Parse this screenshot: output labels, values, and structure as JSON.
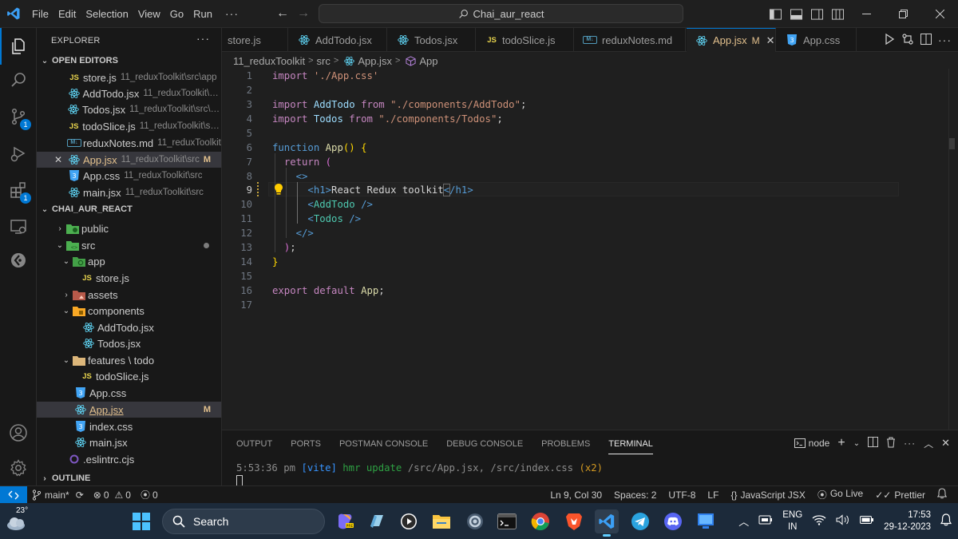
{
  "titlebar": {
    "menu": [
      "File",
      "Edit",
      "Selection",
      "View",
      "Go",
      "Run"
    ],
    "more": "···",
    "search_text": "Chai_aur_react",
    "window_controls": [
      "minimize",
      "restore",
      "close"
    ]
  },
  "activity_bar": {
    "items": [
      "explorer-icon",
      "search-icon",
      "source-control-icon",
      "run-debug-icon",
      "extensions-icon",
      "remote-explorer-icon",
      "git-lens-icon"
    ],
    "source_control_badge": "1",
    "extensions_badge": "1"
  },
  "sidebar": {
    "title": "EXPLORER",
    "more": "···",
    "open_editors_label": "OPEN EDITORS",
    "open_editors": [
      {
        "name": "store.js",
        "path": "11_reduxToolkit\\src\\app",
        "type": "js"
      },
      {
        "name": "AddTodo.jsx",
        "path": "11_reduxToolkit\\sr...",
        "type": "react"
      },
      {
        "name": "Todos.jsx",
        "path": "11_reduxToolkit\\src\\co...",
        "type": "react"
      },
      {
        "name": "todoSlice.js",
        "path": "11_reduxToolkit\\src...",
        "type": "js"
      },
      {
        "name": "reduxNotes.md",
        "path": "11_reduxToolkit",
        "type": "md"
      },
      {
        "name": "App.jsx",
        "path": "11_reduxToolkit\\src",
        "type": "react",
        "badge": "M"
      },
      {
        "name": "App.css",
        "path": "11_reduxToolkit\\src",
        "type": "css"
      },
      {
        "name": "main.jsx",
        "path": "11_reduxToolkit\\src",
        "type": "react"
      }
    ],
    "project_label": "CHAI_AUR_REACT",
    "tree": [
      {
        "name": "public",
        "kind": "folder",
        "depth": 1,
        "open": false
      },
      {
        "name": "src",
        "kind": "folder",
        "depth": 1,
        "open": true
      },
      {
        "name": "app",
        "kind": "folder",
        "depth": 2,
        "open": true
      },
      {
        "name": "store.js",
        "kind": "js",
        "depth": 3
      },
      {
        "name": "assets",
        "kind": "folder",
        "depth": 2,
        "open": false
      },
      {
        "name": "components",
        "kind": "folder",
        "depth": 2,
        "open": true
      },
      {
        "name": "AddTodo.jsx",
        "kind": "react",
        "depth": 3
      },
      {
        "name": "Todos.jsx",
        "kind": "react",
        "depth": 3
      },
      {
        "name": "features \\ todo",
        "kind": "folder",
        "depth": 2,
        "open": true
      },
      {
        "name": "todoSlice.js",
        "kind": "js",
        "depth": 3
      },
      {
        "name": "App.css",
        "kind": "css",
        "depth": 2
      },
      {
        "name": "App.jsx",
        "kind": "react",
        "depth": 2,
        "badge": "M"
      },
      {
        "name": "index.css",
        "kind": "css",
        "depth": 2
      },
      {
        "name": "main.jsx",
        "kind": "react",
        "depth": 2
      },
      {
        "name": ".eslintrc.cjs",
        "kind": "eslint",
        "depth": 1
      }
    ],
    "outline_label": "OUTLINE"
  },
  "tabs": [
    {
      "label": "store.js",
      "type": "js"
    },
    {
      "label": "AddTodo.jsx",
      "type": "react"
    },
    {
      "label": "Todos.jsx",
      "type": "react"
    },
    {
      "label": "todoSlice.js",
      "type": "js"
    },
    {
      "label": "reduxNotes.md",
      "type": "md"
    },
    {
      "label": "App.jsx",
      "type": "react",
      "flag": "M",
      "active": true
    },
    {
      "label": "App.css",
      "type": "css"
    }
  ],
  "breadcrumb": [
    "11_reduxToolkit",
    "src",
    "App.jsx",
    "App"
  ],
  "editor": {
    "current_line": "9",
    "line_numbers": [
      "1",
      "2",
      "3",
      "4",
      "5",
      "6",
      "7",
      "8",
      "9",
      "10",
      "11",
      "12",
      "13",
      "14",
      "15",
      "16",
      "17"
    ]
  },
  "panel": {
    "tabs": [
      "OUTPUT",
      "PORTS",
      "POSTMAN CONSOLE",
      "DEBUG CONSOLE",
      "PROBLEMS",
      "TERMINAL"
    ],
    "active_tab": "TERMINAL",
    "shell": "node",
    "terminal_time": "5:53:36 pm",
    "terminal_vite": "[vite]",
    "terminal_hmr": "hmr update",
    "terminal_files": "/src/App.jsx, /src/index.css",
    "terminal_count": "(x2)"
  },
  "statusbar": {
    "branch": "main*",
    "errors": "0",
    "warnings": "0",
    "ports": "0",
    "cursor": "Ln 9, Col 30",
    "spaces": "Spaces: 2",
    "encoding": "UTF-8",
    "eol": "LF",
    "language": "JavaScript JSX",
    "golive": "Go Live",
    "prettier": "Prettier"
  },
  "taskbar": {
    "temperature": "23°",
    "search_label": "Search",
    "lang_line1": "ENG",
    "lang_line2": "IN",
    "time": "17:53",
    "date": "29-12-2023"
  }
}
